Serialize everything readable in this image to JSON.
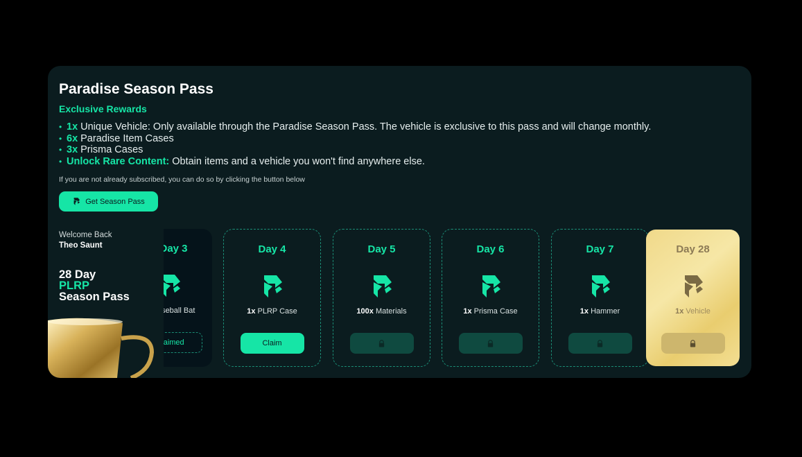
{
  "header": {
    "title": "Paradise Season Pass",
    "subtitle": "Exclusive Rewards"
  },
  "perks": [
    {
      "highlight": "1x",
      "text": "Unique Vehicle: Only available through the Paradise Season Pass. The vehicle is exclusive to this pass and will change monthly."
    },
    {
      "highlight": "6x",
      "text": "Paradise Item Cases"
    },
    {
      "highlight": "3x",
      "text": "Prisma Cases"
    },
    {
      "highlight": "Unlock Rare Content:",
      "text": "Obtain items and a vehicle you won't find anywhere else."
    }
  ],
  "note": "If you are not already subscribed, you can do so by clicking the button below",
  "cta": {
    "label": "Get Season Pass",
    "icon": "plrp-logo-icon"
  },
  "user": {
    "welcome": "Welcome Back",
    "name": "Theo Saunt"
  },
  "pass": {
    "line1": "28 Day",
    "line2": "PLRP",
    "line3": "Season Pass"
  },
  "days": [
    {
      "day": "Day 3",
      "qty": "",
      "item": "Baseball Bat",
      "state": "claimed",
      "button": "Claimed"
    },
    {
      "day": "Day 4",
      "qty": "1x",
      "item": "PLRP Case",
      "state": "claimable",
      "button": "Claim"
    },
    {
      "day": "Day 5",
      "qty": "100x",
      "item": "Materials",
      "state": "locked",
      "button": ""
    },
    {
      "day": "Day 6",
      "qty": "1x",
      "item": "Prisma Case",
      "state": "locked",
      "button": ""
    },
    {
      "day": "Day 7",
      "qty": "1x",
      "item": "Hammer",
      "state": "locked",
      "button": ""
    },
    {
      "day": "Day 28",
      "qty": "1x",
      "item": "Vehicle",
      "state": "locked-gold",
      "button": ""
    }
  ],
  "colors": {
    "accent": "#16e5a6",
    "panel": "#0b1c1f",
    "gold": "#f0d98a"
  }
}
